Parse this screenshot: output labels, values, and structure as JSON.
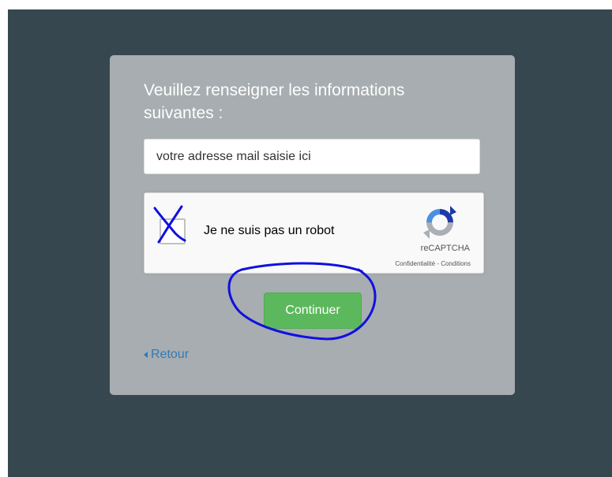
{
  "form": {
    "heading": "Veuillez renseigner les informations suivantes :",
    "email_value": "votre adresse mail saisie ici",
    "continue_label": "Continuer",
    "back_label": "Retour"
  },
  "captcha": {
    "label": "Je ne suis pas un robot",
    "brand": "reCAPTCHA",
    "links": "Confidentialité - Conditions"
  },
  "colors": {
    "page_background": "#37474f",
    "card_background": "#a7adb0",
    "button_green": "#5cb85c",
    "link_blue": "#337ab7",
    "annotation_ink": "#1010e0"
  },
  "annotations": {
    "checkbox_mark": "x-mark",
    "button_highlight": "hand-drawn-circle"
  }
}
